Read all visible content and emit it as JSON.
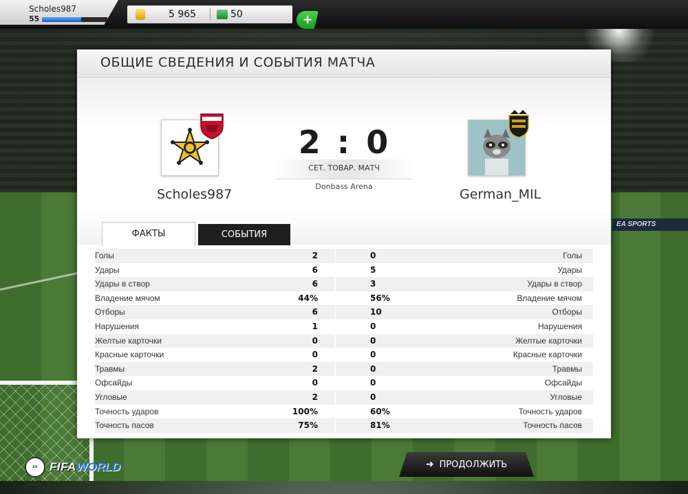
{
  "user": {
    "name": "Scholes987",
    "level": "55",
    "xp_progress": 0.6
  },
  "currency": {
    "coins": "5 965",
    "points": "50",
    "add_label": "+"
  },
  "panel": {
    "title": "ОБЩИЕ СВЕДЕНИЯ И СОБЫТИЯ МАТЧА",
    "home_team": "Scholes987",
    "away_team": "German_MIL",
    "score": "2 : 0",
    "match_type": "СЕТ. ТОВАР. МАТЧ",
    "venue": "Donbass Arena"
  },
  "tabs": [
    {
      "label": "ФАКТЫ",
      "active": true
    },
    {
      "label": "СОБЫТИЯ",
      "active": false
    }
  ],
  "stats": [
    {
      "label": "Голы",
      "home": "2",
      "away": "0"
    },
    {
      "label": "Удары",
      "home": "6",
      "away": "5"
    },
    {
      "label": "Удары в створ",
      "home": "6",
      "away": "3"
    },
    {
      "label": "Владение мячом",
      "home": "44%",
      "away": "56%"
    },
    {
      "label": "Отборы",
      "home": "6",
      "away": "10"
    },
    {
      "label": "Нарушения",
      "home": "1",
      "away": "0"
    },
    {
      "label": "Желтые карточки",
      "home": "0",
      "away": "0"
    },
    {
      "label": "Красные карточки",
      "home": "0",
      "away": "0"
    },
    {
      "label": "Травмы",
      "home": "2",
      "away": "0"
    },
    {
      "label": "Офсайды",
      "home": "0",
      "away": "0"
    },
    {
      "label": "Угловые",
      "home": "2",
      "away": "0"
    },
    {
      "label": "Точность ударов",
      "home": "100%",
      "away": "60%"
    },
    {
      "label": "Точность пасов",
      "home": "75%",
      "away": "81%"
    }
  ],
  "footer": {
    "continue_label": "ПРОДОЛЖИТЬ",
    "logo_ea": "EA SPORTS",
    "logo_fifa": "FIFA",
    "logo_world": "WORLD"
  },
  "stadium": {
    "ad_text": "EA SPORTS"
  },
  "colors": {
    "accent_green": "#2fb53a",
    "panel_bg": "#ffffff",
    "dark_tab": "#1e1e1e",
    "xp_blue": "#2f7fe0"
  }
}
